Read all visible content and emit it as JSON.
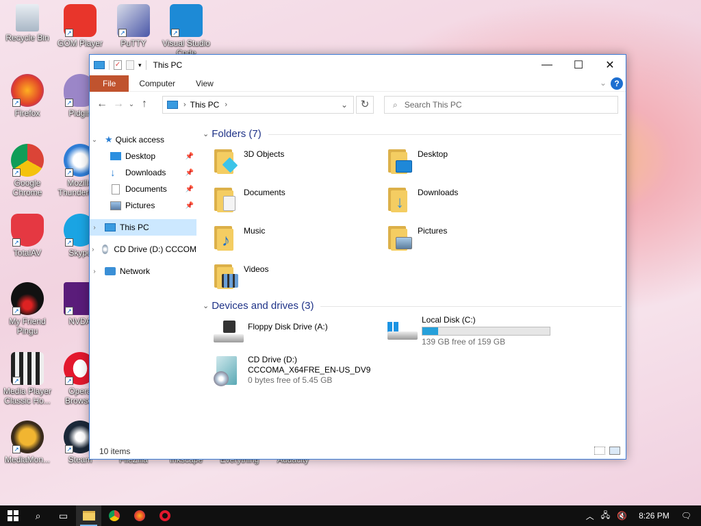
{
  "desktop": {
    "icons": [
      {
        "label": "Recycle Bin",
        "icon": "recycle-bin-icon"
      },
      {
        "label": "GOM Player",
        "icon": "gom-player-icon"
      },
      {
        "label": "PuTTY",
        "icon": "putty-icon"
      },
      {
        "label": "Visual Studio Code",
        "icon": "vscode-icon"
      },
      {
        "label": "Firefox",
        "icon": "firefox-icon"
      },
      {
        "label": "Pidgin",
        "icon": "pidgin-icon"
      },
      {
        "label": "Google Chrome",
        "icon": "chrome-icon"
      },
      {
        "label": "Mozilla Thunderbird",
        "icon": "thunderbird-icon"
      },
      {
        "label": "TotalAV",
        "icon": "totalav-icon"
      },
      {
        "label": "Skype",
        "icon": "skype-icon"
      },
      {
        "label": "My Friend Pingu",
        "icon": "pingu-icon"
      },
      {
        "label": "NVDA",
        "icon": "nvda-icon"
      },
      {
        "label": "Media Player Classic Ho...",
        "icon": "media-player-classic-icon"
      },
      {
        "label": "Opera Browser",
        "icon": "opera-icon"
      },
      {
        "label": "MediaMon...",
        "icon": "mediamonkey-icon"
      },
      {
        "label": "Steam",
        "icon": "steam-icon"
      },
      {
        "label": "FileZilla",
        "icon": "filezilla-icon"
      },
      {
        "label": "Inkscape",
        "icon": "inkscape-icon"
      },
      {
        "label": "Everything",
        "icon": "everything-icon"
      },
      {
        "label": "Audacity",
        "icon": "audacity-icon"
      }
    ]
  },
  "window": {
    "title": "This PC",
    "controls": {
      "minimize": "—",
      "maximize": "☐",
      "close": "✕"
    },
    "ribbon_tabs": [
      "File",
      "Computer",
      "View"
    ],
    "help": "?",
    "address": {
      "crumb": "This PC"
    },
    "search_placeholder": "Search This PC",
    "nav": {
      "quick_access": "Quick access",
      "items": [
        {
          "label": "Desktop",
          "icon": "desktop-folder-icon",
          "pinned": true
        },
        {
          "label": "Downloads",
          "icon": "downloads-folder-icon",
          "pinned": true
        },
        {
          "label": "Documents",
          "icon": "documents-folder-icon",
          "pinned": true
        },
        {
          "label": "Pictures",
          "icon": "pictures-folder-icon",
          "pinned": true
        }
      ],
      "this_pc": "This PC",
      "cd_drive": "CD Drive (D:) CCCOM",
      "network": "Network"
    },
    "folders_header": "Folders (7)",
    "folders": [
      {
        "label": "3D Objects",
        "icon": "3d-objects-folder-icon",
        "overlay": "#3cc4e8"
      },
      {
        "label": "Desktop",
        "icon": "desktop-folder-icon",
        "overlay": "#1e88d8"
      },
      {
        "label": "Documents",
        "icon": "documents-folder-icon",
        "overlay": "#e8e8e8"
      },
      {
        "label": "Downloads",
        "icon": "downloads-folder-icon",
        "overlay": "#2f8bdc"
      },
      {
        "label": "Music",
        "icon": "music-folder-icon",
        "overlay": "#2070c8"
      },
      {
        "label": "Pictures",
        "icon": "pictures-folder-icon",
        "overlay": "#8fb3d8"
      },
      {
        "label": "Videos",
        "icon": "videos-folder-icon",
        "overlay": "#3a3a3a"
      }
    ],
    "devices_header": "Devices and drives (3)",
    "drives": [
      {
        "name": "Floppy Disk Drive (A:)",
        "icon": "floppy-drive-icon"
      },
      {
        "name": "Local Disk (C:)",
        "icon": "local-disk-icon",
        "free": "139 GB free of 159 GB",
        "used_fraction": 0.126
      },
      {
        "name": "CD Drive (D:)",
        "name2": "CCCOMA_X64FRE_EN-US_DV9",
        "icon": "cd-drive-icon",
        "free": "0 bytes free of 5.45 GB"
      }
    ],
    "status": "10 items"
  },
  "taskbar": {
    "clock": "8:26 PM",
    "apps": [
      "start-icon",
      "search-icon",
      "task-view-icon",
      "file-explorer-icon",
      "chrome-icon",
      "firefox-icon",
      "opera-icon"
    ]
  }
}
